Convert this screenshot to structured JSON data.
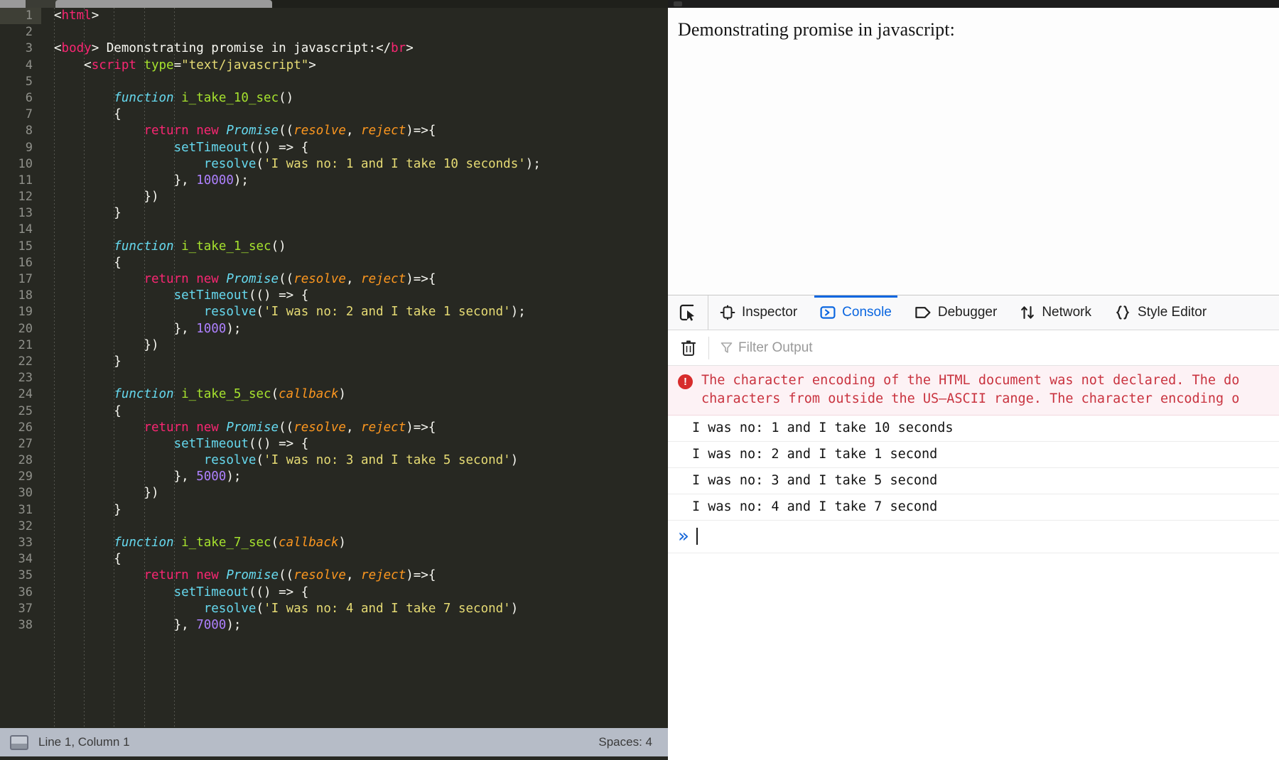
{
  "editor": {
    "tab_label": "",
    "indent_guide_count": 5,
    "lines": [
      {
        "n": 1,
        "current": true,
        "tokens": [
          {
            "c": "t-plain",
            "t": "<"
          },
          {
            "c": "t-tag",
            "t": "html"
          },
          {
            "c": "t-plain",
            "t": ">"
          }
        ]
      },
      {
        "n": 2,
        "current": false,
        "tokens": []
      },
      {
        "n": 3,
        "current": false,
        "tokens": [
          {
            "c": "t-plain",
            "t": "<"
          },
          {
            "c": "t-tag",
            "t": "body"
          },
          {
            "c": "t-plain",
            "t": "> Demonstrating promise in javascript:</"
          },
          {
            "c": "t-tag",
            "t": "br"
          },
          {
            "c": "t-plain",
            "t": ">"
          }
        ]
      },
      {
        "n": 4,
        "current": false,
        "tokens": [
          {
            "c": "t-plain",
            "t": "    <"
          },
          {
            "c": "t-tag",
            "t": "script"
          },
          {
            "c": "t-plain",
            "t": " "
          },
          {
            "c": "t-attr",
            "t": "type"
          },
          {
            "c": "t-plain",
            "t": "="
          },
          {
            "c": "t-str",
            "t": "\"text/javascript\""
          },
          {
            "c": "t-plain",
            "t": ">"
          }
        ]
      },
      {
        "n": 5,
        "current": false,
        "tokens": []
      },
      {
        "n": 6,
        "current": false,
        "tokens": [
          {
            "c": "t-plain",
            "t": "        "
          },
          {
            "c": "t-fn-kw",
            "t": "function"
          },
          {
            "c": "t-plain",
            "t": " "
          },
          {
            "c": "t-fname",
            "t": "i_take_10_sec"
          },
          {
            "c": "t-plain",
            "t": "()"
          }
        ]
      },
      {
        "n": 7,
        "current": false,
        "tokens": [
          {
            "c": "t-plain",
            "t": "        {"
          }
        ]
      },
      {
        "n": 8,
        "current": false,
        "tokens": [
          {
            "c": "t-plain",
            "t": "            "
          },
          {
            "c": "t-kw",
            "t": "return new"
          },
          {
            "c": "t-plain",
            "t": " "
          },
          {
            "c": "t-cls",
            "t": "Promise"
          },
          {
            "c": "t-plain",
            "t": "(("
          },
          {
            "c": "t-param",
            "t": "resolve"
          },
          {
            "c": "t-plain",
            "t": ", "
          },
          {
            "c": "t-param",
            "t": "reject"
          },
          {
            "c": "t-plain",
            "t": ")=>{"
          }
        ]
      },
      {
        "n": 9,
        "current": false,
        "tokens": [
          {
            "c": "t-plain",
            "t": "                "
          },
          {
            "c": "t-meth",
            "t": "setTimeout"
          },
          {
            "c": "t-plain",
            "t": "(() => {"
          }
        ]
      },
      {
        "n": 10,
        "current": false,
        "tokens": [
          {
            "c": "t-plain",
            "t": "                    "
          },
          {
            "c": "t-meth",
            "t": "resolve"
          },
          {
            "c": "t-plain",
            "t": "("
          },
          {
            "c": "t-str",
            "t": "'I was no: 1 and I take 10 seconds'"
          },
          {
            "c": "t-plain",
            "t": ");"
          }
        ]
      },
      {
        "n": 11,
        "current": false,
        "tokens": [
          {
            "c": "t-plain",
            "t": "                }, "
          },
          {
            "c": "t-num",
            "t": "10000"
          },
          {
            "c": "t-plain",
            "t": ");"
          }
        ]
      },
      {
        "n": 12,
        "current": false,
        "tokens": [
          {
            "c": "t-plain",
            "t": "            })"
          }
        ]
      },
      {
        "n": 13,
        "current": false,
        "tokens": [
          {
            "c": "t-plain",
            "t": "        }"
          }
        ]
      },
      {
        "n": 14,
        "current": false,
        "tokens": []
      },
      {
        "n": 15,
        "current": false,
        "tokens": [
          {
            "c": "t-plain",
            "t": "        "
          },
          {
            "c": "t-fn-kw",
            "t": "function"
          },
          {
            "c": "t-plain",
            "t": " "
          },
          {
            "c": "t-fname",
            "t": "i_take_1_sec"
          },
          {
            "c": "t-plain",
            "t": "()"
          }
        ]
      },
      {
        "n": 16,
        "current": false,
        "tokens": [
          {
            "c": "t-plain",
            "t": "        {"
          }
        ]
      },
      {
        "n": 17,
        "current": false,
        "tokens": [
          {
            "c": "t-plain",
            "t": "            "
          },
          {
            "c": "t-kw",
            "t": "return new"
          },
          {
            "c": "t-plain",
            "t": " "
          },
          {
            "c": "t-cls",
            "t": "Promise"
          },
          {
            "c": "t-plain",
            "t": "(("
          },
          {
            "c": "t-param",
            "t": "resolve"
          },
          {
            "c": "t-plain",
            "t": ", "
          },
          {
            "c": "t-param",
            "t": "reject"
          },
          {
            "c": "t-plain",
            "t": ")=>{"
          }
        ]
      },
      {
        "n": 18,
        "current": false,
        "tokens": [
          {
            "c": "t-plain",
            "t": "                "
          },
          {
            "c": "t-meth",
            "t": "setTimeout"
          },
          {
            "c": "t-plain",
            "t": "(() => {"
          }
        ]
      },
      {
        "n": 19,
        "current": false,
        "tokens": [
          {
            "c": "t-plain",
            "t": "                    "
          },
          {
            "c": "t-meth",
            "t": "resolve"
          },
          {
            "c": "t-plain",
            "t": "("
          },
          {
            "c": "t-str",
            "t": "'I was no: 2 and I take 1 second'"
          },
          {
            "c": "t-plain",
            "t": ");"
          }
        ]
      },
      {
        "n": 20,
        "current": false,
        "tokens": [
          {
            "c": "t-plain",
            "t": "                }, "
          },
          {
            "c": "t-num",
            "t": "1000"
          },
          {
            "c": "t-plain",
            "t": ");"
          }
        ]
      },
      {
        "n": 21,
        "current": false,
        "tokens": [
          {
            "c": "t-plain",
            "t": "            })"
          }
        ]
      },
      {
        "n": 22,
        "current": false,
        "tokens": [
          {
            "c": "t-plain",
            "t": "        }"
          }
        ]
      },
      {
        "n": 23,
        "current": false,
        "tokens": []
      },
      {
        "n": 24,
        "current": false,
        "tokens": [
          {
            "c": "t-plain",
            "t": "        "
          },
          {
            "c": "t-fn-kw",
            "t": "function"
          },
          {
            "c": "t-plain",
            "t": " "
          },
          {
            "c": "t-fname",
            "t": "i_take_5_sec"
          },
          {
            "c": "t-plain",
            "t": "("
          },
          {
            "c": "t-param",
            "t": "callback"
          },
          {
            "c": "t-plain",
            "t": ")"
          }
        ]
      },
      {
        "n": 25,
        "current": false,
        "tokens": [
          {
            "c": "t-plain",
            "t": "        {"
          }
        ]
      },
      {
        "n": 26,
        "current": false,
        "tokens": [
          {
            "c": "t-plain",
            "t": "            "
          },
          {
            "c": "t-kw",
            "t": "return new"
          },
          {
            "c": "t-plain",
            "t": " "
          },
          {
            "c": "t-cls",
            "t": "Promise"
          },
          {
            "c": "t-plain",
            "t": "(("
          },
          {
            "c": "t-param",
            "t": "resolve"
          },
          {
            "c": "t-plain",
            "t": ", "
          },
          {
            "c": "t-param",
            "t": "reject"
          },
          {
            "c": "t-plain",
            "t": ")=>{"
          }
        ]
      },
      {
        "n": 27,
        "current": false,
        "tokens": [
          {
            "c": "t-plain",
            "t": "                "
          },
          {
            "c": "t-meth",
            "t": "setTimeout"
          },
          {
            "c": "t-plain",
            "t": "(() => {"
          }
        ]
      },
      {
        "n": 28,
        "current": false,
        "tokens": [
          {
            "c": "t-plain",
            "t": "                    "
          },
          {
            "c": "t-meth",
            "t": "resolve"
          },
          {
            "c": "t-plain",
            "t": "("
          },
          {
            "c": "t-str",
            "t": "'I was no: 3 and I take 5 second'"
          },
          {
            "c": "t-plain",
            "t": ")"
          }
        ]
      },
      {
        "n": 29,
        "current": false,
        "tokens": [
          {
            "c": "t-plain",
            "t": "                }, "
          },
          {
            "c": "t-num",
            "t": "5000"
          },
          {
            "c": "t-plain",
            "t": ");"
          }
        ]
      },
      {
        "n": 30,
        "current": false,
        "tokens": [
          {
            "c": "t-plain",
            "t": "            })"
          }
        ]
      },
      {
        "n": 31,
        "current": false,
        "tokens": [
          {
            "c": "t-plain",
            "t": "        }"
          }
        ]
      },
      {
        "n": 32,
        "current": false,
        "tokens": []
      },
      {
        "n": 33,
        "current": false,
        "tokens": [
          {
            "c": "t-plain",
            "t": "        "
          },
          {
            "c": "t-fn-kw",
            "t": "function"
          },
          {
            "c": "t-plain",
            "t": " "
          },
          {
            "c": "t-fname",
            "t": "i_take_7_sec"
          },
          {
            "c": "t-plain",
            "t": "("
          },
          {
            "c": "t-param",
            "t": "callback"
          },
          {
            "c": "t-plain",
            "t": ")"
          }
        ]
      },
      {
        "n": 34,
        "current": false,
        "tokens": [
          {
            "c": "t-plain",
            "t": "        {"
          }
        ]
      },
      {
        "n": 35,
        "current": false,
        "tokens": [
          {
            "c": "t-plain",
            "t": "            "
          },
          {
            "c": "t-kw",
            "t": "return new"
          },
          {
            "c": "t-plain",
            "t": " "
          },
          {
            "c": "t-cls",
            "t": "Promise"
          },
          {
            "c": "t-plain",
            "t": "(("
          },
          {
            "c": "t-param",
            "t": "resolve"
          },
          {
            "c": "t-plain",
            "t": ", "
          },
          {
            "c": "t-param",
            "t": "reject"
          },
          {
            "c": "t-plain",
            "t": ")=>{"
          }
        ]
      },
      {
        "n": 36,
        "current": false,
        "tokens": [
          {
            "c": "t-plain",
            "t": "                "
          },
          {
            "c": "t-meth",
            "t": "setTimeout"
          },
          {
            "c": "t-plain",
            "t": "(() => {"
          }
        ]
      },
      {
        "n": 37,
        "current": false,
        "tokens": [
          {
            "c": "t-plain",
            "t": "                    "
          },
          {
            "c": "t-meth",
            "t": "resolve"
          },
          {
            "c": "t-plain",
            "t": "("
          },
          {
            "c": "t-str",
            "t": "'I was no: 4 and I take 7 second'"
          },
          {
            "c": "t-plain",
            "t": ")"
          }
        ]
      },
      {
        "n": 38,
        "current": false,
        "tokens": [
          {
            "c": "t-plain",
            "t": "                }, "
          },
          {
            "c": "t-num",
            "t": "7000"
          },
          {
            "c": "t-plain",
            "t": ");"
          }
        ]
      }
    ],
    "statusbar": {
      "cursor": "Line 1, Column 1",
      "indent": "Spaces: 4"
    },
    "colors": {
      "background": "#272822",
      "gutter_text": "#90918b",
      "current_line": "#3e3f36",
      "statusbar_bg": "#b6bcc7"
    }
  },
  "browser": {
    "page": {
      "heading": "Demonstrating promise in javascript:"
    },
    "devtools": {
      "picker_icon": "element-picker-icon",
      "tabs": [
        {
          "label": "Inspector",
          "icon": "inspector-icon",
          "active": false
        },
        {
          "label": "Console",
          "icon": "console-icon",
          "active": true
        },
        {
          "label": "Debugger",
          "icon": "debugger-icon",
          "active": false
        },
        {
          "label": "Network",
          "icon": "network-icon",
          "active": false
        },
        {
          "label": "Style Editor",
          "icon": "style-editor-icon",
          "active": false
        }
      ],
      "clear_icon": "trash-icon",
      "filter": {
        "placeholder": "Filter Output",
        "value": "",
        "icon": "filter-icon"
      },
      "rows": [
        {
          "type": "error",
          "icon": "error-icon",
          "line1": "The character encoding of the HTML document was not declared. The do",
          "line2": "characters from outside the US–ASCII range. The character encoding o"
        },
        {
          "type": "log",
          "text": "I was no: 1 and I take 10 seconds"
        },
        {
          "type": "log",
          "text": "I was no: 2 and I take 1 second"
        },
        {
          "type": "log",
          "text": "I was no: 3 and I take 5 second"
        },
        {
          "type": "log",
          "text": "I was no: 4 and I take 7 second"
        }
      ],
      "prompt": {
        "chevron": "»",
        "value": ""
      },
      "colors": {
        "accent": "#0a66e0",
        "error_text": "#c9333f",
        "error_bg": "#fdf2f5",
        "toolbar_bg": "#f9f9fa"
      }
    }
  }
}
